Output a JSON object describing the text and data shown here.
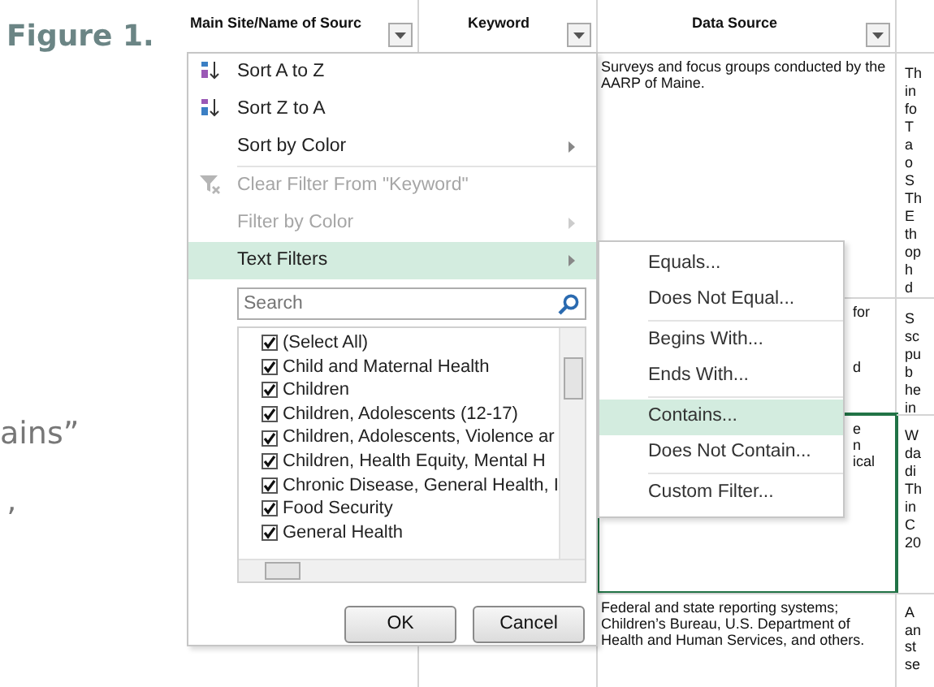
{
  "document": {
    "figure_label": "Figure 1.",
    "fragments": [
      "ains”",
      "’"
    ]
  },
  "sheet": {
    "columns": [
      {
        "title": "Main Site/Name of Sourc",
        "filter": true
      },
      {
        "title": "Keyword",
        "filter": true
      },
      {
        "title": "Data Source",
        "filter": true
      }
    ],
    "rows": [
      {
        "cells": [
          {
            "text": "Surveys and focus groups conducted by the AARP of Maine."
          },
          {
            "lines": [
              "Th",
              "in",
              "fo",
              "T",
              "a",
              "o",
              "S",
              "Th",
              "E",
              "th",
              "op",
              "h",
              "d"
            ]
          }
        ],
        "selected": false
      },
      {
        "cells": [
          {
            "fragments": [
              "for",
              "d"
            ]
          },
          {
            "lines": [
              "S",
              "sc",
              "pu",
              "b",
              "he",
              "in"
            ]
          }
        ],
        "selected": false
      },
      {
        "cells": [
          {
            "fragments": [
              "e",
              "n",
              "ical"
            ]
          },
          {
            "lines": [
              "W",
              "da",
              "di",
              "Th",
              "in",
              "C",
              "20"
            ]
          }
        ],
        "selected": true
      },
      {
        "cells": [
          {
            "text": "Federal and state reporting systems; Children’s Bureau, U.S. Department of Health and Human Services, and others."
          },
          {
            "lines": [
              "A",
              "an",
              "st",
              "se"
            ]
          }
        ],
        "selected": false
      }
    ]
  },
  "filter_menu": {
    "items": [
      {
        "label": "Sort A to Z",
        "disabled": false,
        "submenu": false,
        "selected": false
      },
      {
        "label": "Sort Z to A",
        "disabled": false,
        "submenu": false,
        "selected": false
      },
      {
        "label": "Sort by Color",
        "disabled": false,
        "submenu": true,
        "selected": false
      },
      {
        "label": "Clear Filter From \"Keyword\"",
        "disabled": true,
        "submenu": false,
        "selected": false
      },
      {
        "label": "Filter by Color",
        "disabled": true,
        "submenu": true,
        "selected": false
      },
      {
        "label": "Text Filters",
        "disabled": false,
        "submenu": true,
        "selected": true
      }
    ],
    "search": {
      "placeholder": "Search"
    },
    "values": [
      {
        "label": "(Select All)",
        "checked": true
      },
      {
        "label": "Child and Maternal Health",
        "checked": true
      },
      {
        "label": "Children",
        "checked": true
      },
      {
        "label": "Children, Adolescents (12-17)",
        "checked": true
      },
      {
        "label": "Children, Adolescents, Violence ar",
        "checked": true
      },
      {
        "label": "Children, Health Equity, Mental H",
        "checked": true
      },
      {
        "label": "Chronic Disease, General Health, I",
        "checked": true
      },
      {
        "label": "Food Security",
        "checked": true
      },
      {
        "label": "General Health",
        "checked": true
      }
    ],
    "buttons": [
      "OK",
      "Cancel"
    ]
  },
  "text_filters_menu": {
    "groups": [
      [
        {
          "label": "Equals...",
          "selected": false
        },
        {
          "label": "Does Not Equal...",
          "selected": false
        }
      ],
      [
        {
          "label": "Begins With...",
          "selected": false
        },
        {
          "label": "Ends With...",
          "selected": false
        }
      ],
      [
        {
          "label": "Contains...",
          "selected": true
        },
        {
          "label": "Does Not Contain...",
          "selected": false
        }
      ],
      [
        {
          "label": "Custom Filter...",
          "selected": false
        }
      ]
    ]
  }
}
